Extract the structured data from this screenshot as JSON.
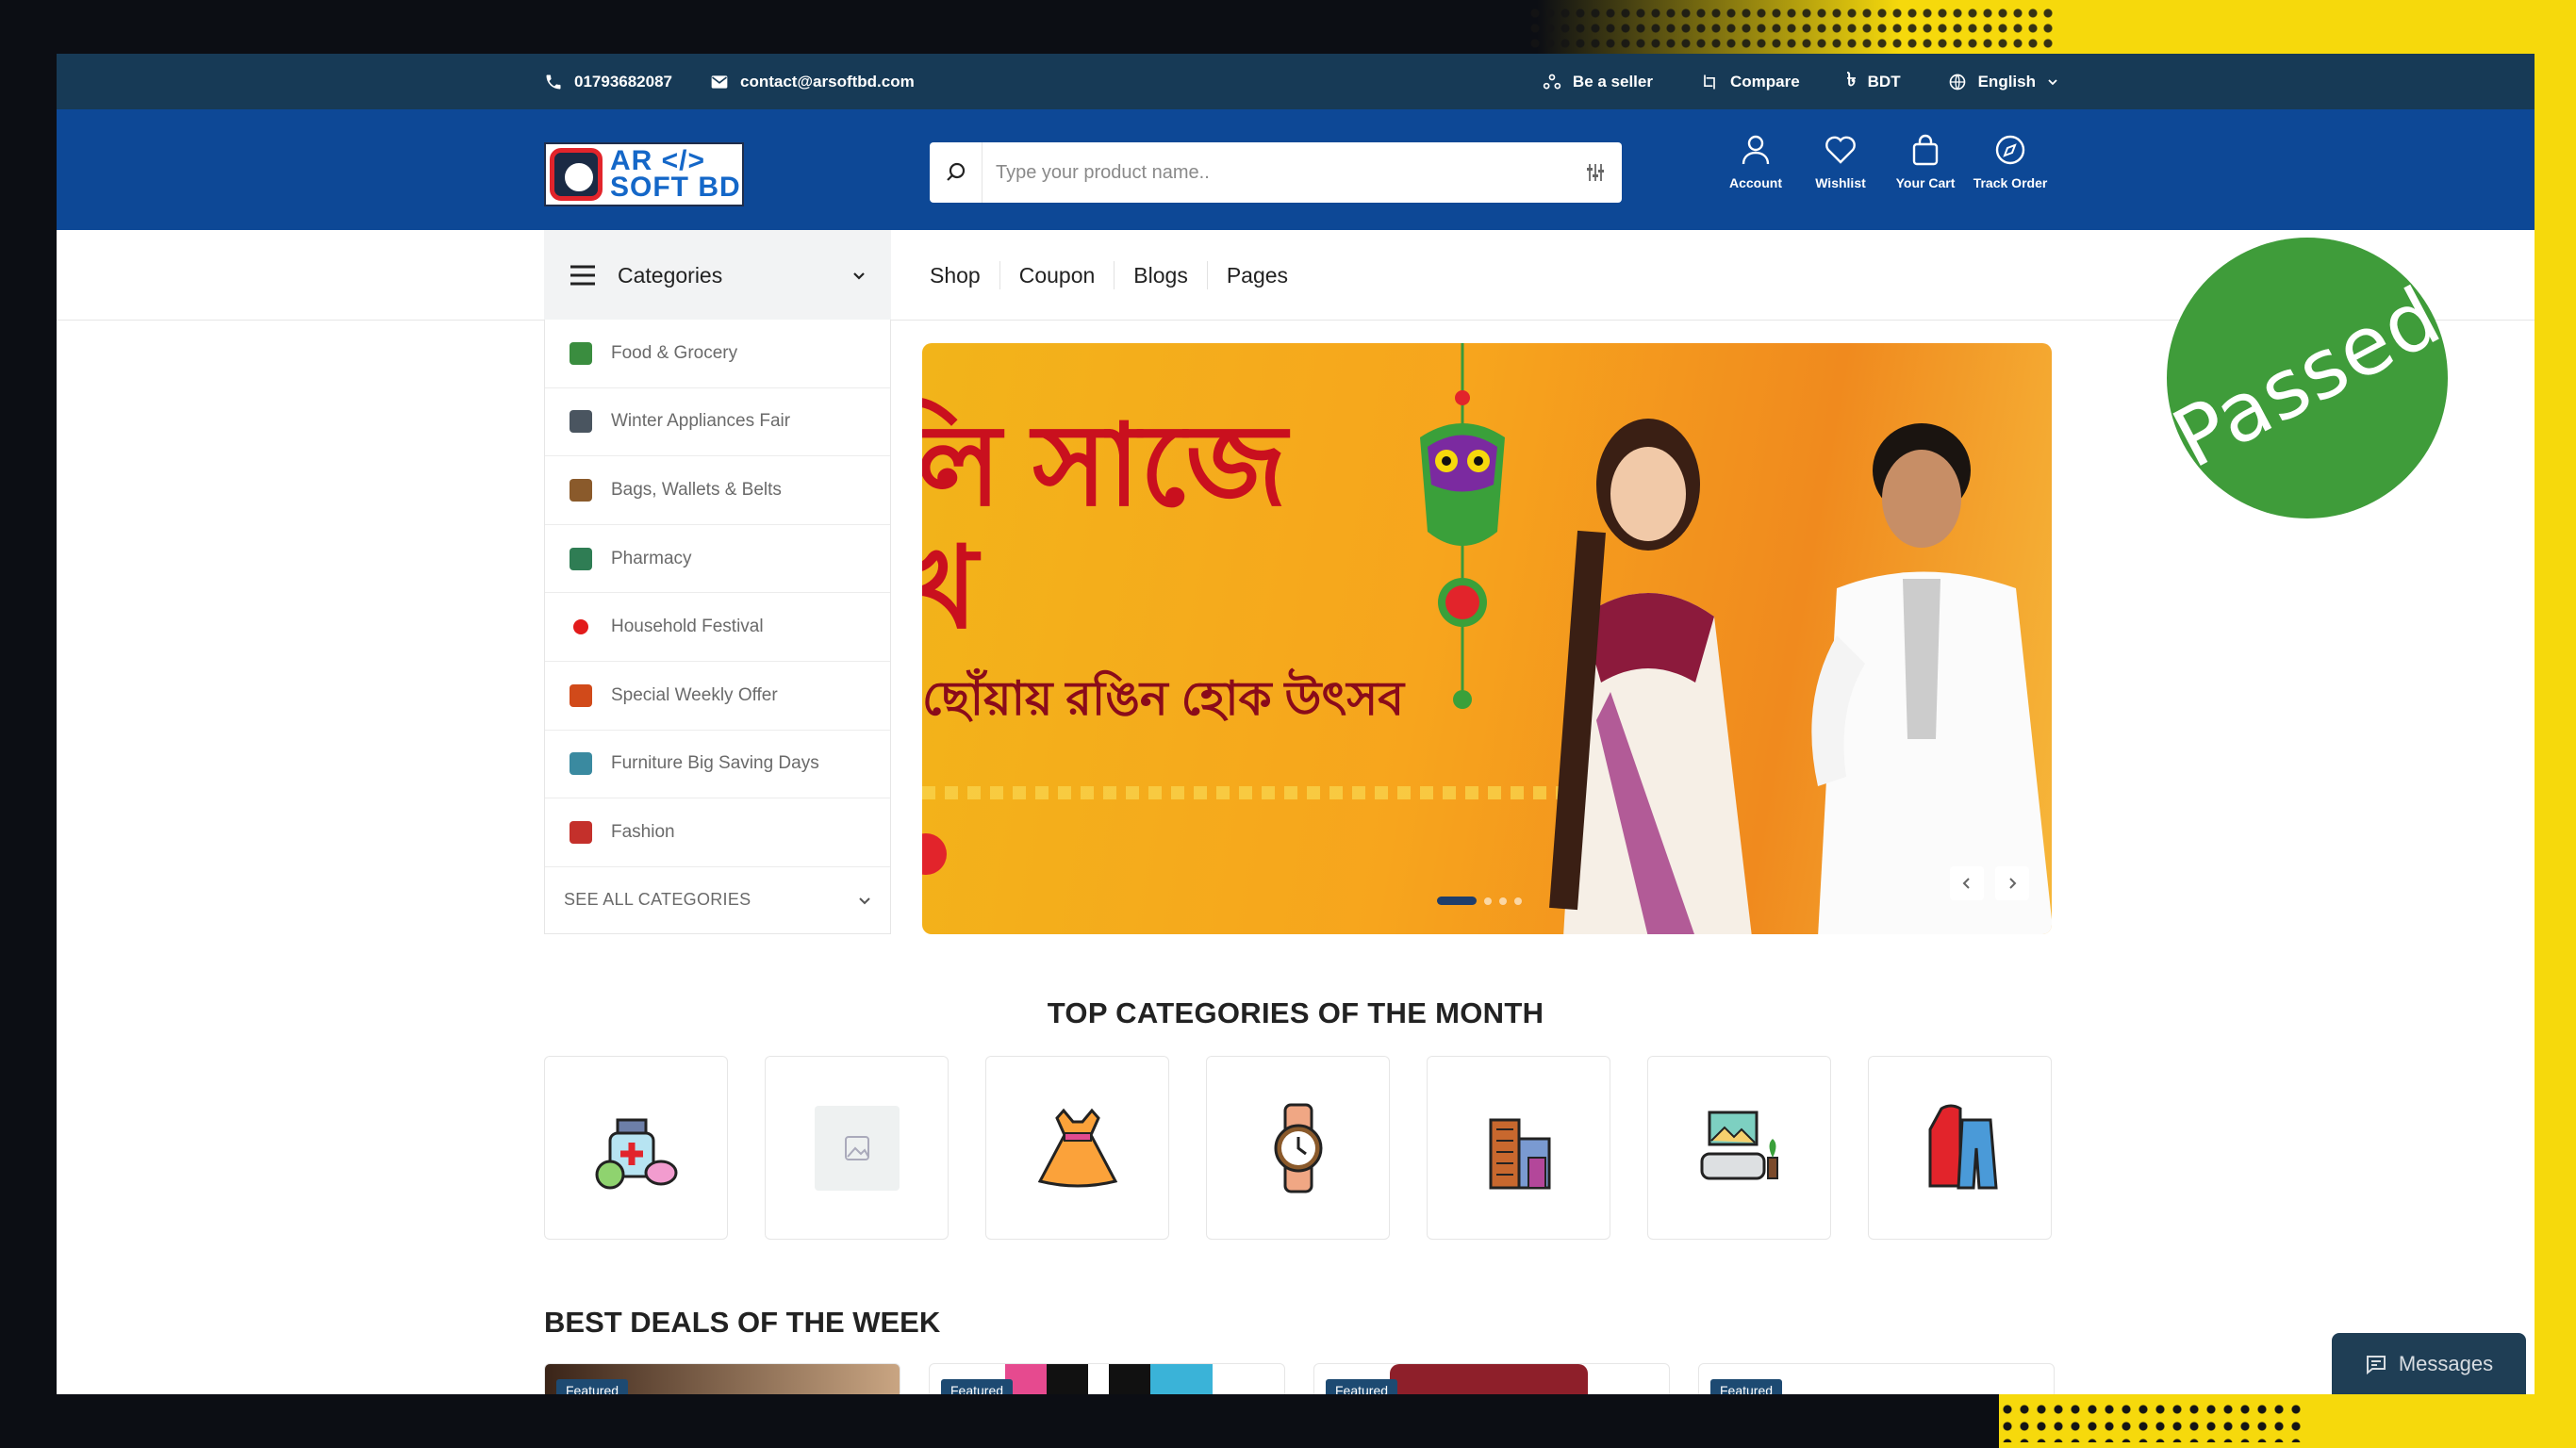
{
  "topbar": {
    "phone": "01793682087",
    "email": "contact@arsoftbd.com",
    "be_seller": "Be a seller",
    "compare": "Compare",
    "currency": "BDT",
    "language": "English"
  },
  "header": {
    "logo_line1": "AR </>",
    "logo_line2": "SOFT BD",
    "search_placeholder": "Type your product name..",
    "icons": [
      {
        "label": "Account",
        "icon": "user-icon"
      },
      {
        "label": "Wishlist",
        "icon": "heart-icon"
      },
      {
        "label": "Your Cart",
        "icon": "bag-icon"
      },
      {
        "label": "Track Order",
        "icon": "compass-icon"
      }
    ]
  },
  "nav": {
    "categories_label": "Categories",
    "menu": [
      "Shop",
      "Coupon",
      "Blogs",
      "Pages"
    ]
  },
  "sidebar": {
    "items": [
      {
        "label": "Food & Grocery",
        "color": "#3a8d3f"
      },
      {
        "label": "Winter Appliances Fair",
        "color": "#4a5560"
      },
      {
        "label": "Bags, Wallets & Belts",
        "color": "#8a5a2b"
      },
      {
        "label": "Pharmacy",
        "color": "#2f7d54"
      },
      {
        "label": "Household Festival",
        "color": "#e21b1b"
      },
      {
        "label": "Special Weekly Offer",
        "color": "#d14a1a"
      },
      {
        "label": "Furniture Big Saving Days",
        "color": "#3a8aa0"
      },
      {
        "label": "Fashion",
        "color": "#c4302b"
      }
    ],
    "see_all": "SEE ALL CATEGORIES"
  },
  "banner": {
    "line1": "লি সাজে",
    "line2": "খ",
    "subtitle": "ছোঁয়ায় রঙিন হোক উৎসব",
    "slides": 4,
    "active_slide": 1
  },
  "top_categories": {
    "title": "TOP CATEGORIES OF THE MONTH",
    "items": [
      "pharmacy-icon",
      "image-placeholder-icon",
      "kids-dress-icon",
      "watch-icon",
      "building-icon",
      "furniture-icon",
      "clothing-icon"
    ]
  },
  "best_deals": {
    "title": "BEST DEALS OF THE WEEK",
    "badges": [
      "Featured",
      "Featured",
      "Featured",
      "Featured"
    ]
  },
  "overlay": {
    "stamp": "Passed",
    "messages": "Messages"
  },
  "colors": {
    "topbar": "#173a56",
    "header": "#0d4896",
    "stamp": "#3f9c3a",
    "accent_yellow": "#f6d90c"
  }
}
